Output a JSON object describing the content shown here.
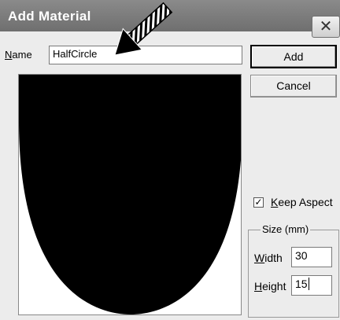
{
  "dialog": {
    "title": "Add Material",
    "close_glyph": "✕",
    "name_label_mnemonic": "N",
    "name_label_rest": "ame",
    "name_value": "HalfCircle",
    "add_label": "Add",
    "cancel_label": "Cancel",
    "keep_aspect_mnemonic": "K",
    "keep_aspect_rest": "eep Aspect",
    "keep_aspect_checked": true,
    "check_glyph": "✓",
    "size_group_label": "Size (mm)",
    "width_mnemonic": "W",
    "width_rest": "idth",
    "width_value": "30",
    "height_mnemonic": "H",
    "height_rest": "eight",
    "height_value": "15"
  },
  "annotation": {
    "arrow_icon": "arrow-pointer-icon",
    "color": "#000000"
  },
  "preview": {
    "shape": "half-circle",
    "fill": "#000000",
    "background": "#ffffff"
  }
}
